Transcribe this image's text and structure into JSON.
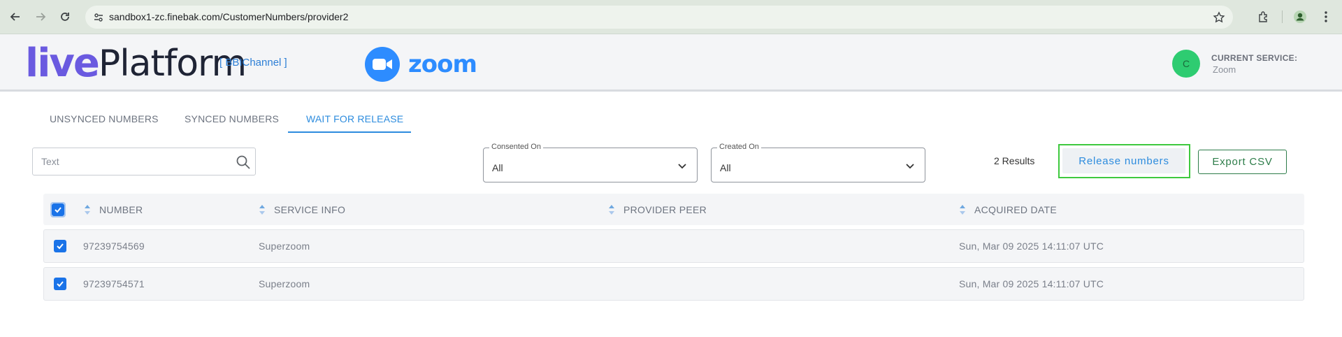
{
  "browser": {
    "url": "sandbox1-zc.finebak.com/CustomerNumbers/provider2"
  },
  "header": {
    "logo_live": "live",
    "logo_platform": "Platform",
    "channel_tag": "[ BBIChannel ]",
    "zoom_label": "zoom",
    "avatar_initial": "C",
    "current_service_label": "CURRENT SERVICE:",
    "current_service_value": "Zoom"
  },
  "tabs": [
    {
      "label": "UNSYNCED NUMBERS",
      "active": false
    },
    {
      "label": "SYNCED NUMBERS",
      "active": false
    },
    {
      "label": "WAIT FOR RELEASE",
      "active": true
    }
  ],
  "filters": {
    "search_placeholder": "Text",
    "consented_on": {
      "label": "Consented On",
      "value": "All"
    },
    "created_on": {
      "label": "Created On",
      "value": "All"
    }
  },
  "results_text": "2 Results",
  "actions": {
    "release_label": "Release numbers",
    "export_label": "Export CSV"
  },
  "table": {
    "columns": [
      "NUMBER",
      "SERVICE INFO",
      "PROVIDER PEER",
      "ACQUIRED DATE"
    ],
    "rows": [
      {
        "number": "97239754569",
        "service_info": "Superzoom",
        "provider_peer": "",
        "acquired_date": "Sun, Mar 09 2025 14:11:07 UTC",
        "checked": true
      },
      {
        "number": "97239754571",
        "service_info": "Superzoom",
        "provider_peer": "",
        "acquired_date": "Sun, Mar 09 2025 14:11:07 UTC",
        "checked": true
      }
    ]
  },
  "colors": {
    "accent_blue": "#2d8cde",
    "checkbox_blue": "#1a73e8",
    "export_green": "#2e7d4a",
    "highlight_green": "#3ec93e",
    "zoom_blue": "#2d8cff"
  }
}
